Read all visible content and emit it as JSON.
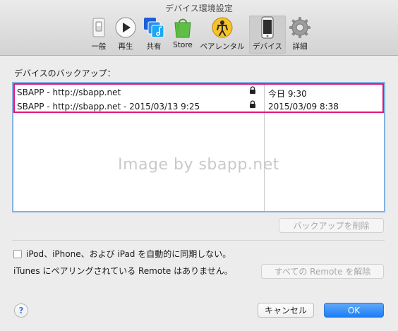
{
  "window": {
    "title": "デバイス環境設定"
  },
  "toolbar": {
    "items": [
      {
        "label": "一般",
        "icon": "general-switch-icon"
      },
      {
        "label": "再生",
        "icon": "play-icon"
      },
      {
        "label": "共有",
        "icon": "sharing-icon"
      },
      {
        "label": "Store",
        "icon": "store-bag-icon"
      },
      {
        "label": "ペアレンタル",
        "icon": "parental-icon"
      },
      {
        "label": "デバイス",
        "icon": "device-icon",
        "selected": true
      },
      {
        "label": "詳細",
        "icon": "gear-icon"
      }
    ]
  },
  "backups": {
    "label": "デバイスのバックアップ：",
    "rows": [
      {
        "name": "SBAPP - http://sbapp.net",
        "date": "今日 9:30",
        "locked": true
      },
      {
        "name": "SBAPP - http://sbapp.net - 2015/03/13 9:25",
        "date": "2015/03/09 8:38",
        "locked": true
      }
    ],
    "watermark": "Image by sbapp.net",
    "highlight_color": "#e2167a",
    "delete_button": "バックアップを削除"
  },
  "sync": {
    "prevent_auto_sync_label": "iPod、iPhone、および iPad を自動的に同期しない。",
    "prevent_auto_sync_checked": false,
    "remote_note": "iTunes にペアリングされている Remote はありません。",
    "forget_remotes_button": "すべての Remote を解除"
  },
  "footer": {
    "help": "?",
    "cancel_button": "キャンセル",
    "ok_button": "OK"
  },
  "colors": {
    "accent": "#1a7ef6",
    "table_border": "#84b1e0"
  }
}
